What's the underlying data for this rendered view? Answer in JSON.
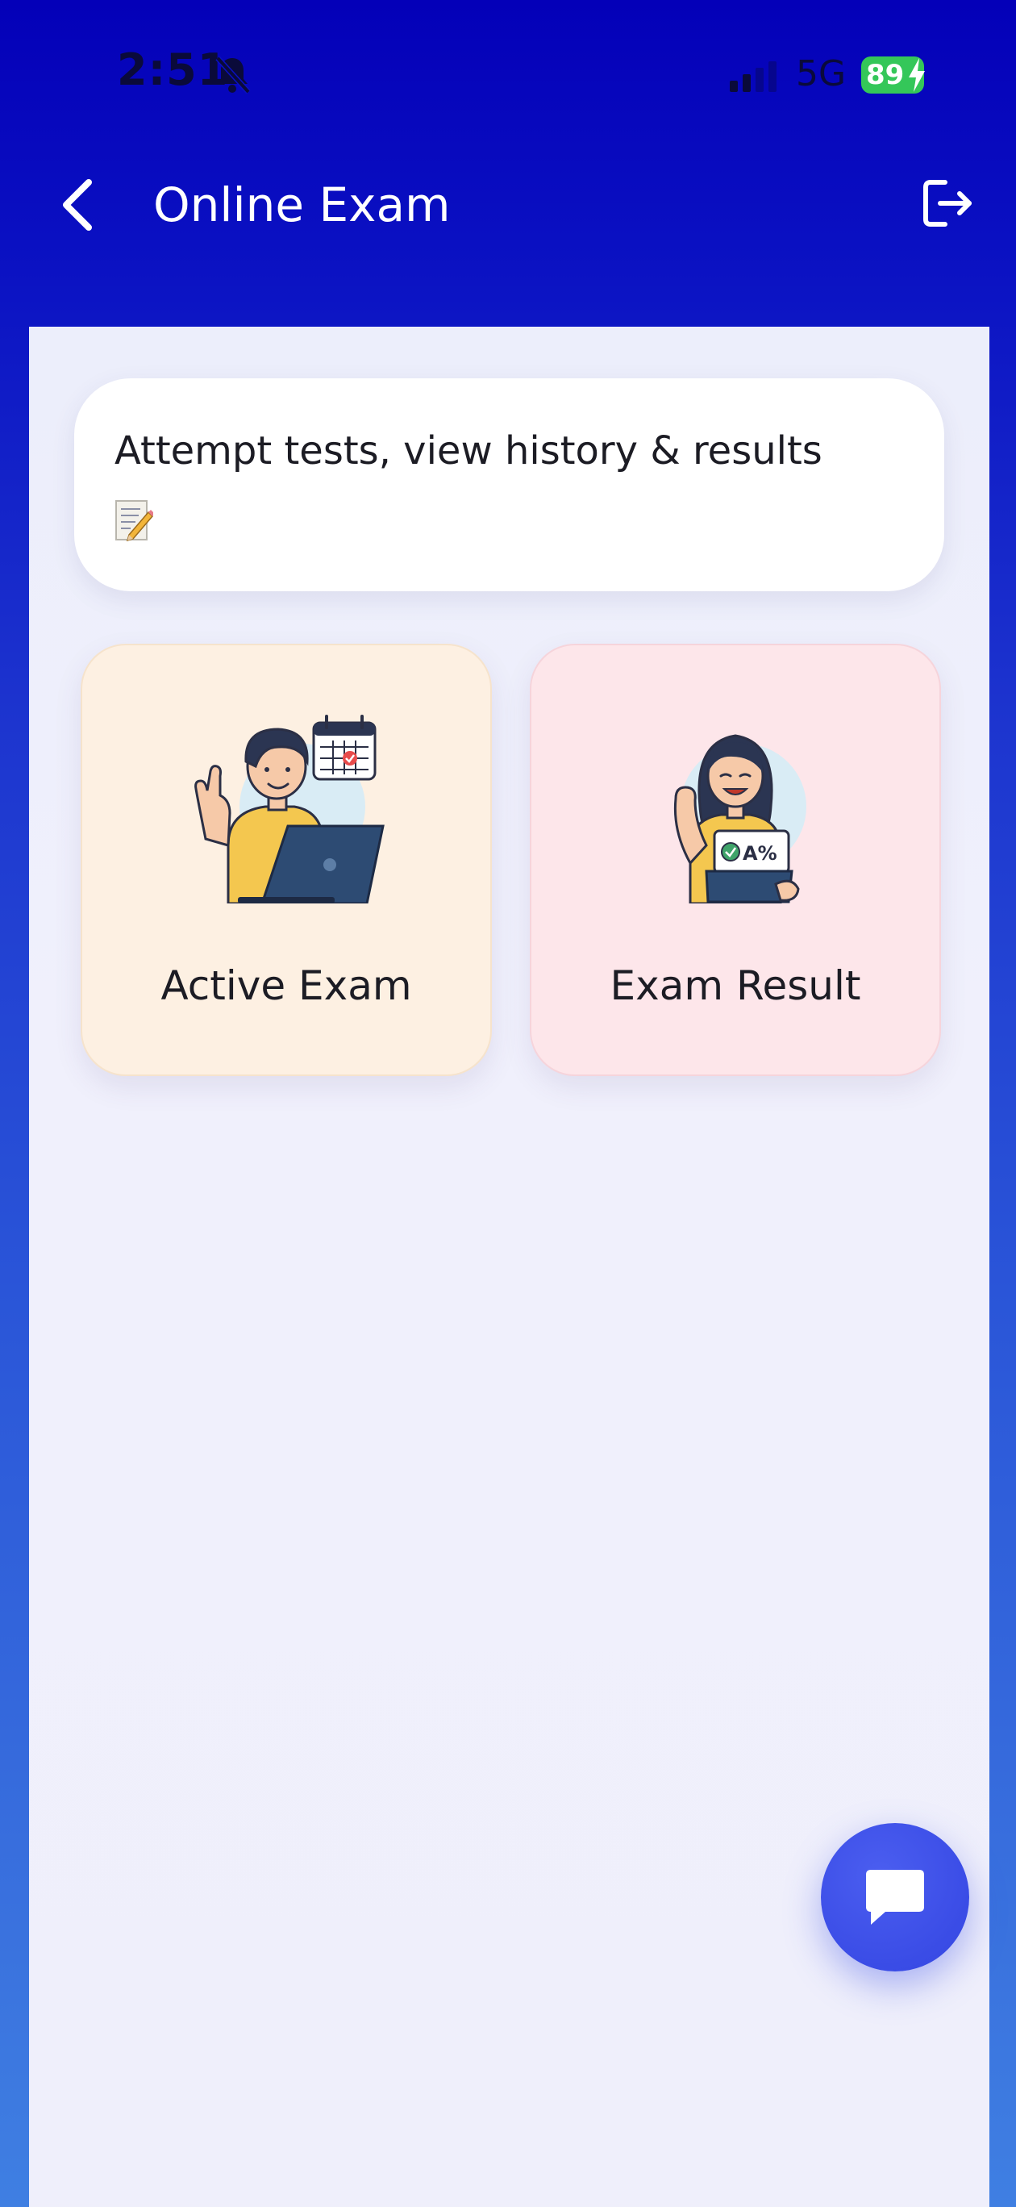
{
  "status_bar": {
    "time": "2:51",
    "network": "5G",
    "battery": "89",
    "icons": [
      "bell-slash-icon",
      "signal-icon",
      "charging-bolt-icon"
    ]
  },
  "app_bar": {
    "title": "Online Exam",
    "icons": [
      "back-chevron-icon",
      "logout-icon"
    ]
  },
  "intro": {
    "text": "Attempt tests, view history & results",
    "icon": "memo-icon"
  },
  "tiles": [
    {
      "label": "Active Exam",
      "illustration": "boy-with-laptop-calendar",
      "background": "#fdf0e2"
    },
    {
      "label": "Exam Result",
      "illustration": "girl-with-tablet-grade"
    }
  ],
  "result_badge": "A%",
  "fab": {
    "icon": "chat-bubble-icon"
  },
  "colors": {
    "header": "#0400b8",
    "fab": "#3a4ce6",
    "battery": "#34c759"
  }
}
